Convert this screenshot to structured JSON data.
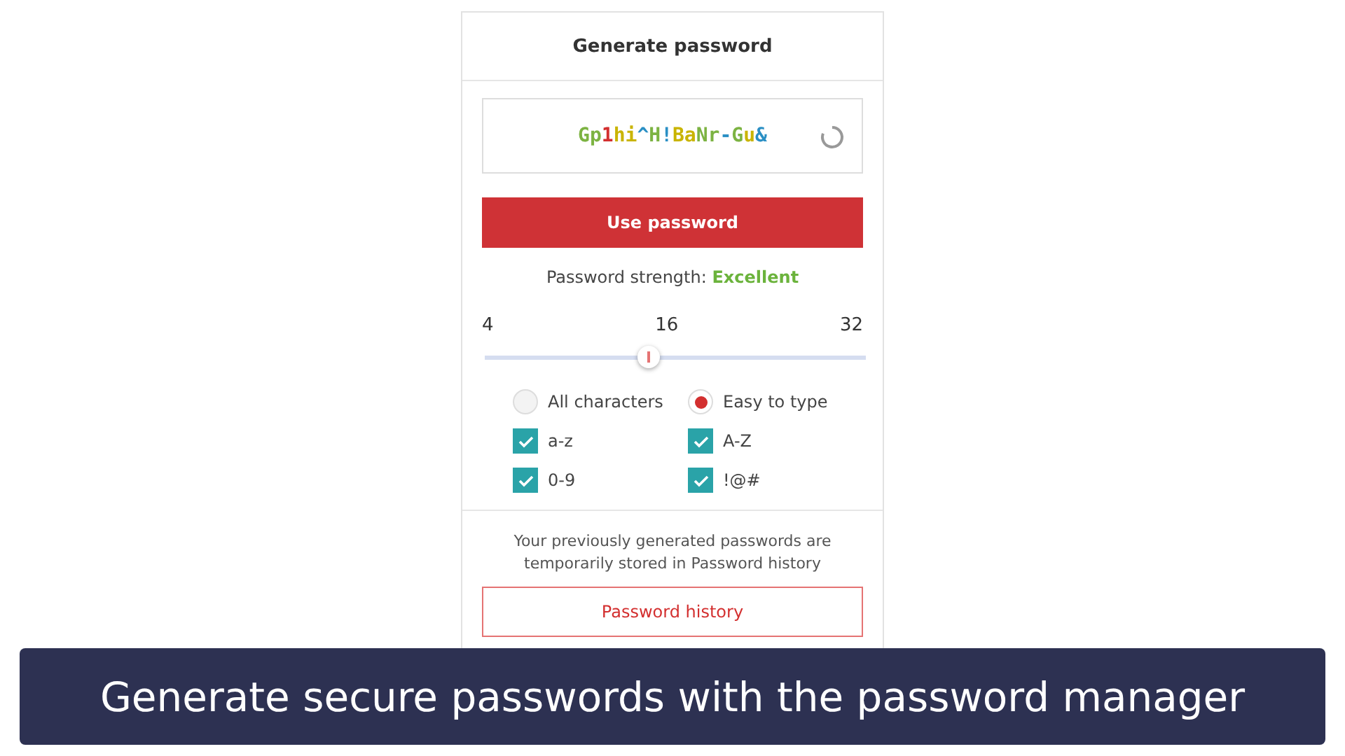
{
  "panel": {
    "title": "Generate password",
    "password": [
      {
        "text": "Gp",
        "color": "#7cb342"
      },
      {
        "text": "1",
        "color": "#d32f2f"
      },
      {
        "text": "hi",
        "color": "#c9b400"
      },
      {
        "text": "^",
        "color": "#2a8fc4"
      },
      {
        "text": "H",
        "color": "#7cb342"
      },
      {
        "text": "!",
        "color": "#2a8fc4"
      },
      {
        "text": "Ba",
        "color": "#c9b400"
      },
      {
        "text": "Nr",
        "color": "#7cb342"
      },
      {
        "text": "-",
        "color": "#2a8fc4"
      },
      {
        "text": "G",
        "color": "#7cb342"
      },
      {
        "text": "u",
        "color": "#c9b400"
      },
      {
        "text": "&",
        "color": "#2a8fc4"
      }
    ],
    "use_button": "Use password",
    "strength_label": "Password strength:",
    "strength_value": "Excellent",
    "length": {
      "min": "4",
      "current": "16",
      "max": "32",
      "level": 0.43
    },
    "modes": [
      {
        "label": "All characters",
        "selected": false
      },
      {
        "label": "Easy to type",
        "selected": true
      }
    ],
    "options": [
      {
        "label": "a-z",
        "checked": true
      },
      {
        "label": "A-Z",
        "checked": true
      },
      {
        "label": "0-9",
        "checked": true
      },
      {
        "label": "!@#",
        "checked": true
      }
    ],
    "history_note": "Your previously generated passwords are temporarily stored in Password history",
    "history_button": "Password history"
  },
  "caption": "Generate secure passwords with the password manager"
}
